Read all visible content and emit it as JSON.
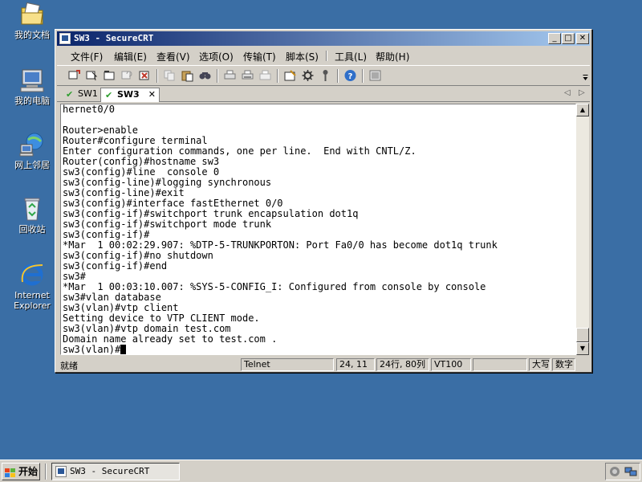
{
  "desktop": {
    "icons": [
      {
        "name": "我的文档",
        "icon": "my-documents-icon"
      },
      {
        "name": "我的电脑",
        "icon": "my-computer-icon"
      },
      {
        "name": "网上邻居",
        "icon": "network-places-icon"
      },
      {
        "name": "回收站",
        "icon": "recycle-bin-icon"
      },
      {
        "name": "Internet Explorer",
        "line1": "Internet",
        "line2": "Explorer",
        "icon": "internet-explorer-icon"
      }
    ]
  },
  "window": {
    "title": "SW3 - SecureCRT",
    "menu": [
      "文件(F)",
      "编辑(E)",
      "查看(V)",
      "选项(O)",
      "传输(T)",
      "脚本(S)",
      "工具(L)",
      "帮助(H)"
    ],
    "tabs": [
      {
        "label": "SW1",
        "active": false
      },
      {
        "label": "SW3",
        "active": true
      }
    ],
    "tab_close": "✕",
    "terminal_lines": [
      "hernet0/0",
      "",
      "Router>enable",
      "Router#configure terminal",
      "Enter configuration commands, one per line.  End with CNTL/Z.",
      "Router(config)#hostname sw3",
      "sw3(config)#line  console 0",
      "sw3(config-line)#logging synchronous",
      "sw3(config-line)#exit",
      "sw3(config)#interface fastEthernet 0/0",
      "sw3(config-if)#switchport trunk encapsulation dot1q",
      "sw3(config-if)#switchport mode trunk",
      "sw3(config-if)#",
      "*Mar  1 00:02:29.907: %DTP-5-TRUNKPORTON: Port Fa0/0 has become dot1q trunk",
      "sw3(config-if)#no shutdown",
      "sw3(config-if)#end",
      "sw3#",
      "*Mar  1 00:03:10.007: %SYS-5-CONFIG_I: Configured from console by console",
      "sw3#vlan database",
      "sw3(vlan)#vtp client",
      "Setting device to VTP CLIENT mode.",
      "sw3(vlan)#vtp domain test.com",
      "Domain name already set to test.com ."
    ],
    "prompt": "sw3(vlan)#",
    "status": {
      "ready": "就绪",
      "protocol": "Telnet",
      "position": "24, 11",
      "size": "24行, 80列",
      "emulation": "VT100",
      "caps": "大写",
      "num": "数字"
    }
  },
  "taskbar": {
    "start": "开始",
    "task": "SW3 - SecureCRT"
  }
}
